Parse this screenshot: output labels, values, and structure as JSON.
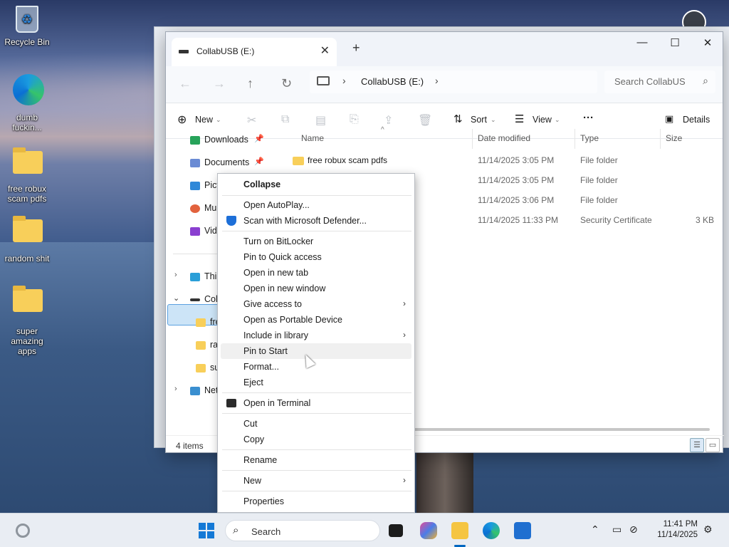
{
  "desktop": {
    "icons": [
      {
        "label": "Recycle Bin"
      },
      {
        "label": "dumb fuckin..."
      },
      {
        "label": "free robux scam pdfs"
      },
      {
        "label": "random shit"
      },
      {
        "label": "super amazing apps"
      }
    ]
  },
  "explorer": {
    "tab_title": "CollabUSB (E:)",
    "tab_close": "✕",
    "new_tab": "+",
    "window_controls": {
      "minimize": "—",
      "maximize": "☐",
      "close": "✕"
    },
    "breadcrumb": {
      "drive": "CollabUSB (E:)",
      "sep1": "›",
      "sep2": "›"
    },
    "search_placeholder": "Search CollabUS",
    "toolbar": {
      "new_label": "New",
      "sort_label": "Sort",
      "view_label": "View",
      "more_label": "···",
      "details_label": "Details"
    },
    "sidebar": {
      "items": [
        {
          "label": "Downloads",
          "pinned": true
        },
        {
          "label": "Documents",
          "pinned": true
        },
        {
          "label": "Pict"
        },
        {
          "label": "Mu"
        },
        {
          "label": "Vid"
        },
        {
          "label": "Thi"
        },
        {
          "label": "Coll"
        },
        {
          "label": "fre"
        },
        {
          "label": "ra"
        },
        {
          "label": "su"
        },
        {
          "label": "Net"
        }
      ]
    },
    "columns": {
      "name": "Name",
      "date": "Date modified",
      "type": "Type",
      "size": "Size"
    },
    "files": [
      {
        "name": "free robux scam pdfs",
        "date": "11/14/2025 3:05 PM",
        "type": "File folder",
        "size": ""
      },
      {
        "name": "",
        "date": "11/14/2025 3:05 PM",
        "type": "File folder",
        "size": ""
      },
      {
        "name": "",
        "date": "11/14/2025 3:06 PM",
        "type": "File folder",
        "size": ""
      },
      {
        "name": "",
        "date": "11/14/2025 11:33 PM",
        "type": "Security Certificate",
        "size": "3 KB"
      }
    ],
    "status": "4 items"
  },
  "context_menu": {
    "items": [
      {
        "label": "Collapse",
        "bold": true
      },
      {
        "label": "Open AutoPlay..."
      },
      {
        "label": "Scan with Microsoft Defender..."
      },
      {
        "label": "Turn on BitLocker"
      },
      {
        "label": "Pin to Quick access"
      },
      {
        "label": "Open in new tab"
      },
      {
        "label": "Open in new window"
      },
      {
        "label": "Give access to",
        "submenu": true
      },
      {
        "label": "Open as Portable Device"
      },
      {
        "label": "Include in library",
        "submenu": true
      },
      {
        "label": "Pin to Start",
        "hovered": true
      },
      {
        "label": "Format..."
      },
      {
        "label": "Eject"
      },
      {
        "label": "Open in Terminal"
      },
      {
        "label": "Cut"
      },
      {
        "label": "Copy"
      },
      {
        "label": "Rename"
      },
      {
        "label": "New",
        "submenu": true
      },
      {
        "label": "Properties"
      }
    ],
    "submenu_arrow": "›"
  },
  "taskbar": {
    "search_placeholder": "Search",
    "time": "11:41 PM",
    "date": "11/14/2025"
  },
  "colors": {
    "accent": "#0067c0",
    "selection": "#cce4f7",
    "folder": "#f8cf5a"
  }
}
